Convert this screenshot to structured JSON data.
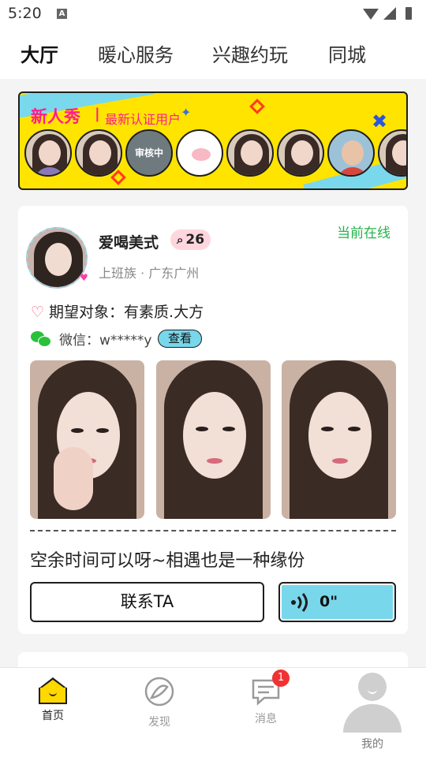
{
  "status": {
    "time": "5:20",
    "notif_icon": "A"
  },
  "tabs": [
    {
      "label": "大厅",
      "active": true
    },
    {
      "label": "暖心服务",
      "active": false
    },
    {
      "label": "兴趣约玩",
      "active": false
    },
    {
      "label": "同城",
      "active": false
    }
  ],
  "banner": {
    "title": "新人秀",
    "separator": "|",
    "subtitle": "最新认证用户",
    "close_icon": "✖",
    "avatars": [
      {
        "type": "cartoon-girl"
      },
      {
        "type": "girl"
      },
      {
        "type": "review",
        "label": "审核中"
      },
      {
        "type": "pig"
      },
      {
        "type": "girl"
      },
      {
        "type": "girl"
      },
      {
        "type": "man"
      },
      {
        "type": "cartoon-girl"
      }
    ]
  },
  "card": {
    "name": "爱喝美式",
    "badge_icon": "search-bubble",
    "badge_count": "26",
    "online": "当前在线",
    "meta": "上班族 · 广东广州",
    "expect_label": "期望对象：有素质.大方",
    "wechat_label": "微信：",
    "wechat_value": "w*****y",
    "view_button": "查看",
    "slogan": "空余时间可以呀~相遇也是一种缘份",
    "contact_button": "联系TA",
    "voice_duration": "0\""
  },
  "bottom_nav": [
    {
      "label": "首页",
      "active": true
    },
    {
      "label": "发现",
      "active": false
    },
    {
      "label": "消息",
      "active": false,
      "badge": "1"
    },
    {
      "label": "我的",
      "active": false
    }
  ],
  "colors": {
    "accent_yellow": "#ffd800",
    "banner_pink": "#ff1d8e",
    "online_green": "#24b24a",
    "cyan": "#78d7ea",
    "badge_red": "#f13232"
  }
}
